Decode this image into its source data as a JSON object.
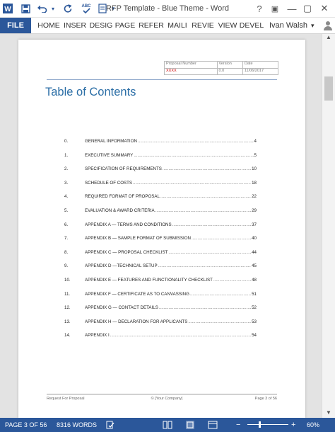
{
  "window": {
    "title": "RFP Template - Blue Theme - Word",
    "help_label": "?",
    "quick_access_icons": [
      "word-app-icon",
      "save-icon",
      "undo-icon",
      "redo-icon",
      "spelling-check-icon",
      "touch-mode-icon",
      "customize-qat-icon"
    ],
    "controls": {
      "ribbon_options": "▣",
      "minimize": "—",
      "maximize": "▢",
      "close": "✕"
    }
  },
  "ribbon": {
    "file_label": "FILE",
    "tabs": [
      "HOME",
      "INSER",
      "DESIG",
      "PAGE",
      "REFER",
      "MAILI",
      "REVIE",
      "VIEW",
      "DEVEL"
    ],
    "user": "Ivan Walsh",
    "chevron": "▾"
  },
  "document": {
    "header": {
      "col1_label": "Proposal Number",
      "col2_label": "Version",
      "col3_label": "Date",
      "col1_value": "XXXX",
      "col2_value": "0.0",
      "col3_value": "11/06/2017"
    },
    "toc_title": "Table of Contents",
    "toc": [
      {
        "num": "0.",
        "label": "GENERAL INFORMATION",
        "page": "4"
      },
      {
        "num": "1.",
        "label": "EXECUTIVE SUMMARY",
        "page": "5"
      },
      {
        "num": "2.",
        "label": "SPECIFICATION OF REQUIREMENTS",
        "page": "10"
      },
      {
        "num": "3.",
        "label": "SCHEDULE OF COSTS",
        "page": "18"
      },
      {
        "num": "4.",
        "label": "REQUIRED FORMAT OF PROPOSAL",
        "page": "22"
      },
      {
        "num": "5.",
        "label": "EVALUATION & AWARD CRITERIA",
        "page": "29"
      },
      {
        "num": "6.",
        "label": "APPENDIX A — TERMS AND CONDITIONS",
        "page": "37"
      },
      {
        "num": "7.",
        "label": "APPENDIX B — SAMPLE FORMAT OF SUBMISSION",
        "page": "40"
      },
      {
        "num": "8.",
        "label": "APPENDIX C — PROPOSAL CHECKLIST",
        "page": "44"
      },
      {
        "num": "9.",
        "label": "APPENDIX D —TECHNICAL SETUP",
        "page": "45"
      },
      {
        "num": "10.",
        "label": "APPENDIX E — FEATURES AND FUNCTIONALITY CHECKLIST",
        "page": "48"
      },
      {
        "num": "11.",
        "label": "APPENDIX F — CERTIFICATE AS TO CANVASSING",
        "page": "51"
      },
      {
        "num": "12.",
        "label": "APPENDIX G — CONTACT DETAILS",
        "page": "52"
      },
      {
        "num": "13.",
        "label": "APPENDIX H — DECLARATION FOR APPLICANTS",
        "page": "53"
      },
      {
        "num": "14.",
        "label": "APPENDIX I",
        "page": "54"
      }
    ],
    "footer": {
      "left": "Request For Proposal",
      "center": "© [Your Company]",
      "right": "Page 3 of 56"
    }
  },
  "status_bar": {
    "page": "PAGE 3 OF 56",
    "words": "8316 WORDS",
    "zoom": "60%",
    "zoom_minus": "−",
    "zoom_plus": "+",
    "zoom_level_fraction": 0.3
  },
  "colors": {
    "accent": "#2b579a",
    "heading": "#2b6ea6",
    "placeholder_red": "#cc0000"
  }
}
